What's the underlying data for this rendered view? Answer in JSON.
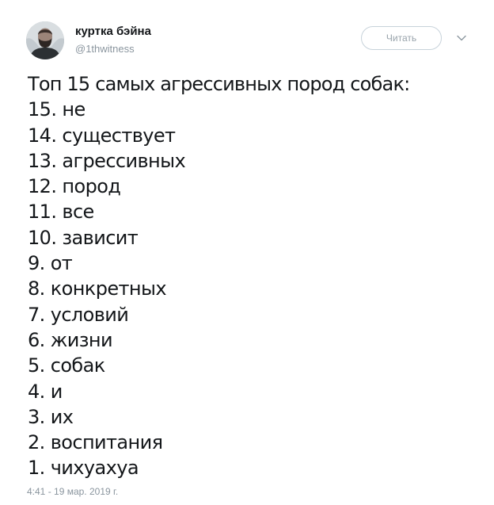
{
  "user": {
    "display_name": "куртка бэйна",
    "handle": "@1thwitness"
  },
  "follow_button": {
    "label": "Читать"
  },
  "icons": {
    "avatar": "user-avatar-photo",
    "caret": "chevron-down-icon"
  },
  "tweet": {
    "lines": [
      "Топ 15 самых агрессивных пород собак:",
      "15. не",
      "14. существует",
      "13. агрессивных",
      "12. пород",
      "11. все",
      "10. зависит",
      "9. от",
      "8. конкретных",
      "7. условий",
      "6. жизни",
      "5. собак",
      "4. и",
      "3. их",
      "2. воспитания",
      "1. чихуахуа"
    ],
    "timestamp": "4:41 - 19 мар. 2019 г."
  },
  "colors": {
    "text": "#14171a",
    "muted": "#8a959e",
    "button_border": "#c7d2da"
  }
}
